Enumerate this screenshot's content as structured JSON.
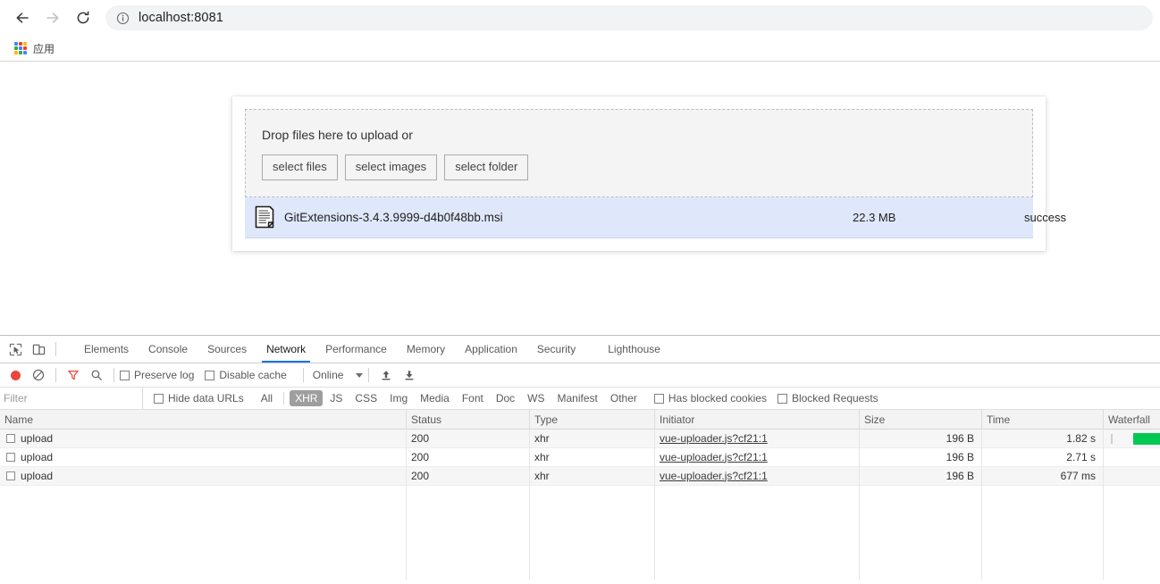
{
  "browser": {
    "back_label": "Back",
    "forward_label": "Forward",
    "reload_label": "Reload",
    "url": "localhost:8081",
    "bookmark_label": "应用"
  },
  "uploader": {
    "dropzone_text": "Drop files here to upload or",
    "buttons": [
      {
        "label": "select files",
        "name": "select-files-button"
      },
      {
        "label": "select images",
        "name": "select-images-button"
      },
      {
        "label": "select folder",
        "name": "select-folder-button"
      }
    ],
    "file": {
      "name": "GitExtensions-3.4.3.9999-d4b0f48bb.msi",
      "size": "22.3 MB",
      "status": "success"
    }
  },
  "devtools": {
    "tabs": [
      "Elements",
      "Console",
      "Sources",
      "Network",
      "Performance",
      "Memory",
      "Application",
      "Security",
      "Lighthouse"
    ],
    "active_tab": "Network",
    "toolbar": {
      "preserve_log": "Preserve log",
      "disable_cache": "Disable cache",
      "throttle": "Online"
    },
    "filterbar": {
      "filter_placeholder": "Filter",
      "hide_data_urls": "Hide data URLs",
      "types": [
        "All",
        "XHR",
        "JS",
        "CSS",
        "Img",
        "Media",
        "Font",
        "Doc",
        "WS",
        "Manifest",
        "Other"
      ],
      "active_type": "XHR",
      "has_blocked_cookies": "Has blocked cookies",
      "blocked_requests": "Blocked Requests"
    },
    "table": {
      "columns": [
        "Name",
        "Status",
        "Type",
        "Initiator",
        "Size",
        "Time",
        "Waterfall"
      ],
      "rows": [
        {
          "name": "upload",
          "status": "200",
          "type": "xhr",
          "initiator": "vue-uploader.js?cf21:1",
          "size": "196 B",
          "time": "1.82 s",
          "waterfall_bar": true
        },
        {
          "name": "upload",
          "status": "200",
          "type": "xhr",
          "initiator": "vue-uploader.js?cf21:1",
          "size": "196 B",
          "time": "2.71 s",
          "waterfall_bar": false
        },
        {
          "name": "upload",
          "status": "200",
          "type": "xhr",
          "initiator": "vue-uploader.js?cf21:1",
          "size": "196 B",
          "time": "677 ms",
          "waterfall_bar": false
        }
      ]
    }
  },
  "colors": {
    "accent": "#1a73e8",
    "record": "#e8483b",
    "waterfall": "#00c853",
    "file_row": "#dfe8fb"
  }
}
